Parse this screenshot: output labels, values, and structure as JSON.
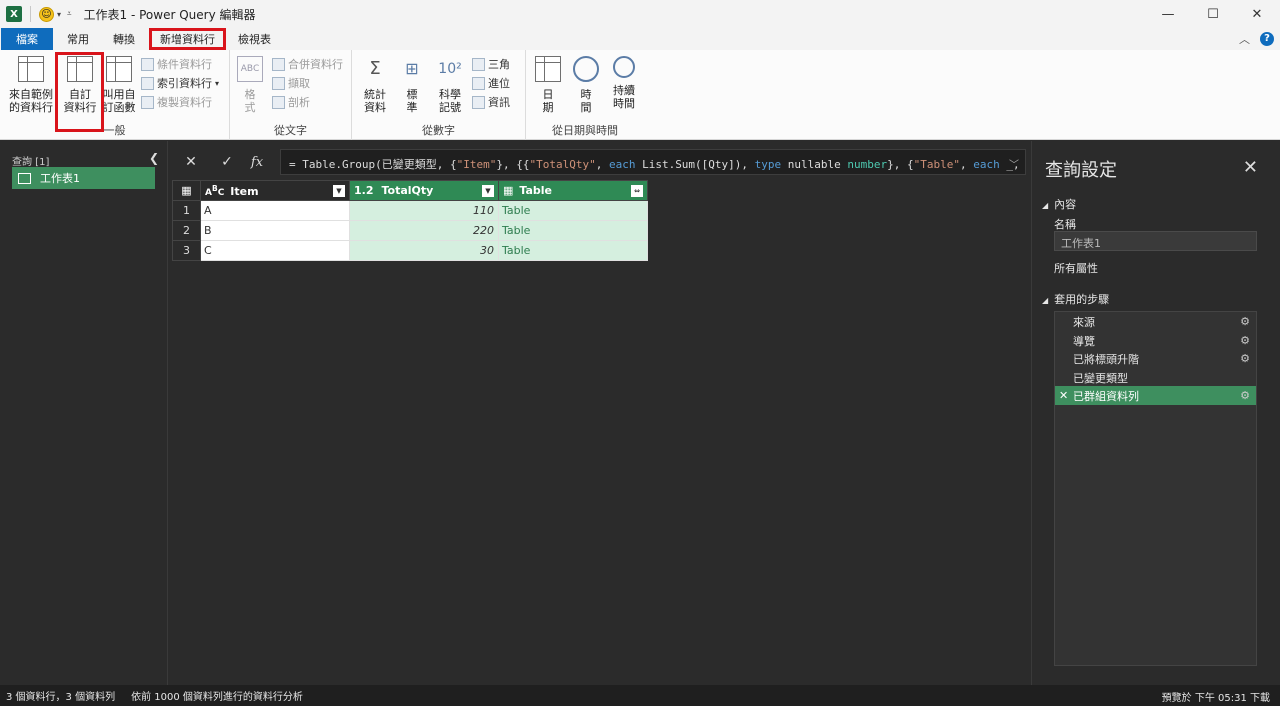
{
  "window": {
    "title": "工作表1 - Power Query 編輯器",
    "app_icon": "X",
    "controls": [
      "minimize",
      "maximize",
      "close"
    ]
  },
  "tabs": [
    {
      "label": "檔案",
      "state": "file"
    },
    {
      "label": "常用",
      "state": "normal"
    },
    {
      "label": "轉換",
      "state": "normal"
    },
    {
      "label": "新增資料行",
      "state": "active"
    },
    {
      "label": "檢視表",
      "state": "normal"
    }
  ],
  "ribbon": {
    "groups": {
      "general": {
        "label": "一般",
        "example_col": "來自範例\n的資料行",
        "custom_col": "自訂\n資料行",
        "invoke_func": "叫用自\n訂函數",
        "conditional": "條件資料行",
        "index": "索引資料行",
        "duplicate": "複製資料行"
      },
      "text": {
        "label": "從文字",
        "format": "格\n式",
        "merge": "合併資料行",
        "extract": "擷取",
        "parse": "剖析"
      },
      "number": {
        "label": "從數字",
        "stats": "統計\n資料",
        "standard": "標\n準",
        "scientific": "科學\n記號",
        "trig": "三角",
        "rounding": "進位",
        "info": "資訊"
      },
      "datetime": {
        "label": "從日期與時間",
        "date": "日\n期",
        "time": "時\n間",
        "duration": "持續\n時間"
      }
    }
  },
  "queries": {
    "header": "查詢 [1]",
    "items": [
      "工作表1"
    ]
  },
  "formula": {
    "fx": "fx",
    "parts": [
      {
        "t": "= Table.Group(已變更類型, {",
        "c": ""
      },
      {
        "t": "\"Item\"",
        "c": "str"
      },
      {
        "t": "}, {{",
        "c": ""
      },
      {
        "t": "\"TotalQty\"",
        "c": "str"
      },
      {
        "t": ", ",
        "c": ""
      },
      {
        "t": "each",
        "c": "kw"
      },
      {
        "t": " List.Sum([Qty]), ",
        "c": ""
      },
      {
        "t": "type",
        "c": "kw"
      },
      {
        "t": " nullable ",
        "c": ""
      },
      {
        "t": "number",
        "c": "ty"
      },
      {
        "t": "}, {",
        "c": ""
      },
      {
        "t": "\"Table\"",
        "c": "str"
      },
      {
        "t": ", ",
        "c": ""
      },
      {
        "t": "each",
        "c": "kw"
      },
      {
        "t": " _,",
        "c": ""
      }
    ]
  },
  "grid": {
    "columns": [
      {
        "type_label": "ABC",
        "name": "Item"
      },
      {
        "type_label": "1.2",
        "name": "TotalQty"
      },
      {
        "type_label": "table",
        "name": "Table"
      }
    ],
    "rows": [
      {
        "n": "1",
        "item": "A",
        "qty": "110",
        "table": "Table"
      },
      {
        "n": "2",
        "item": "B",
        "qty": "220",
        "table": "Table"
      },
      {
        "n": "3",
        "item": "C",
        "qty": "30",
        "table": "Table"
      }
    ]
  },
  "settings": {
    "title": "查詢設定",
    "properties_header": "內容",
    "name_label": "名稱",
    "name_value": "工作表1",
    "all_props": "所有屬性",
    "steps_header": "套用的步驟",
    "steps": [
      {
        "label": "來源",
        "gear": true
      },
      {
        "label": "導覽",
        "gear": true
      },
      {
        "label": "已將標頭升階",
        "gear": true
      },
      {
        "label": "已變更類型",
        "gear": false
      },
      {
        "label": "已群組資料列",
        "gear": true,
        "selected": true
      }
    ]
  },
  "status": {
    "left1": "3 個資料行，3 個資料列",
    "left2": "依前 1000 個資料列進行的資料行分析",
    "right": "預覽於 下午 05:31 下載"
  },
  "colors": {
    "accent": "#0f6cbd",
    "green": "#3e8f5f",
    "highlight": "#d9141b"
  }
}
